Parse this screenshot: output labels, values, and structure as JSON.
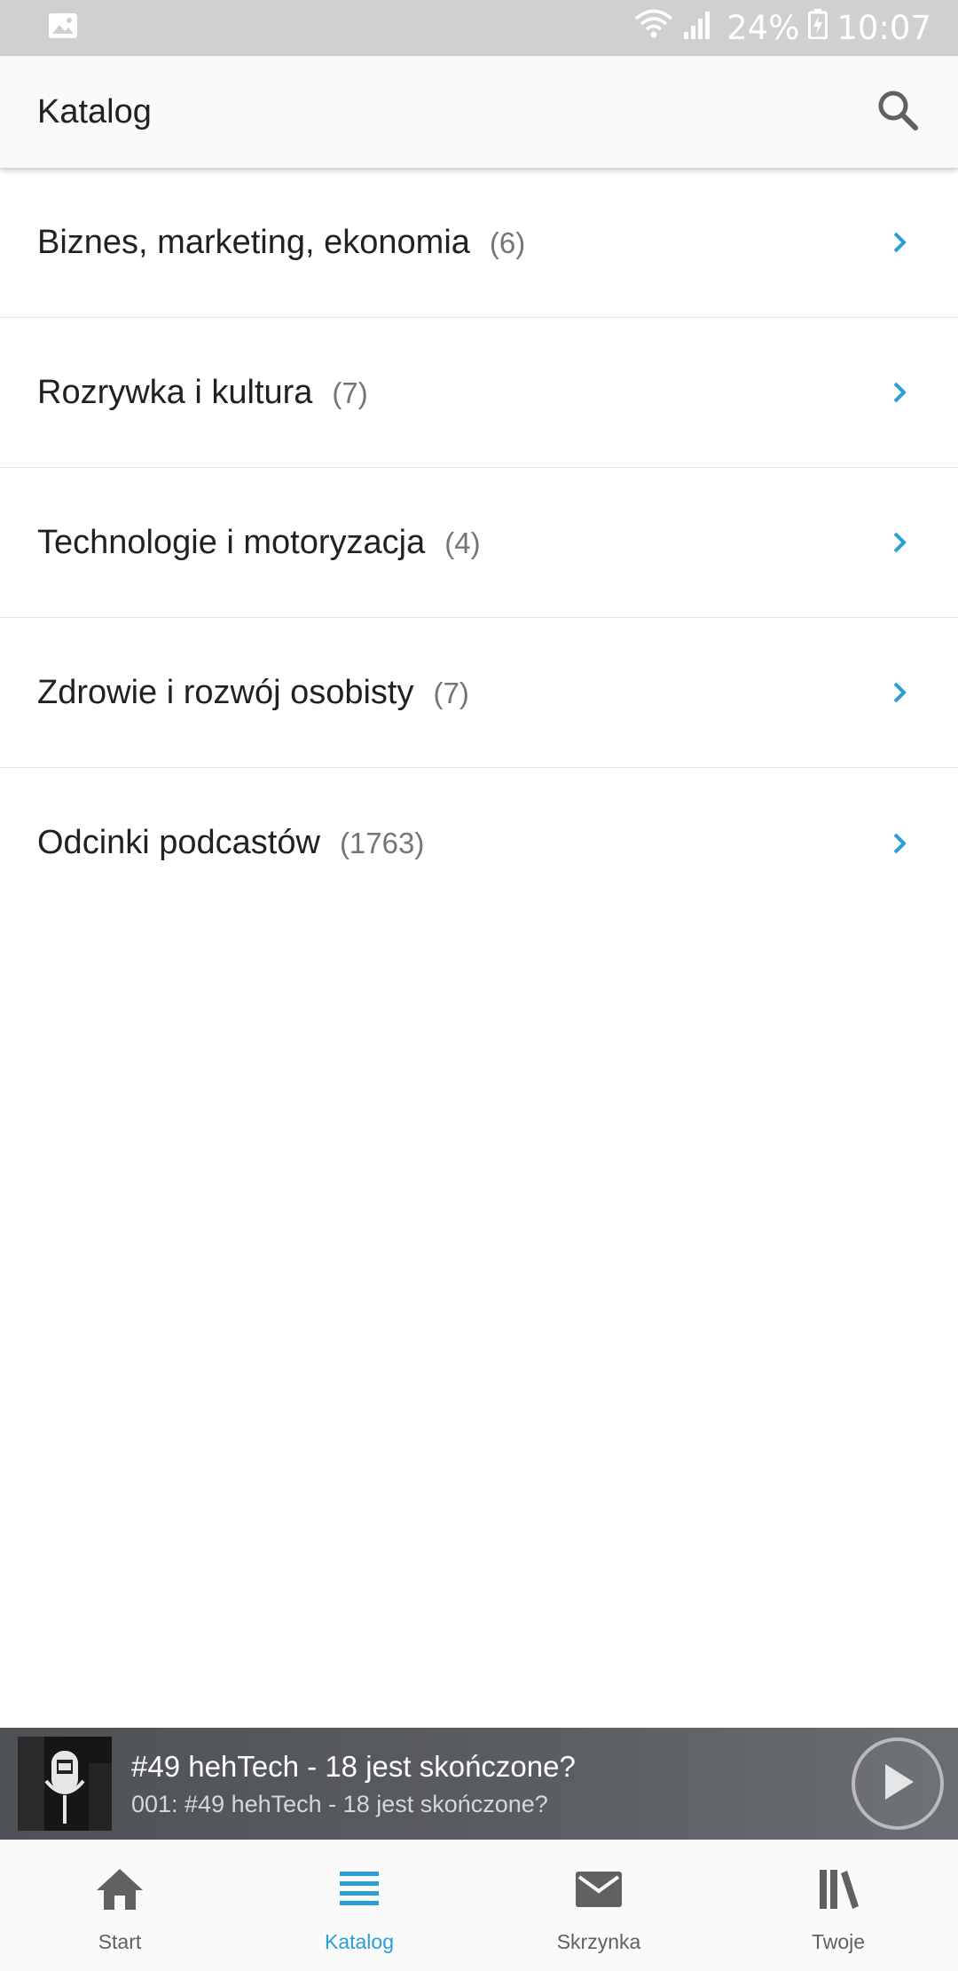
{
  "status_bar": {
    "battery": "24%",
    "time": "10:07",
    "icons": [
      "gallery-notification-icon",
      "wifi-icon",
      "signal-icon",
      "battery-charging-icon"
    ]
  },
  "app_bar": {
    "title": "Katalog",
    "search_icon": "search-icon"
  },
  "categories": [
    {
      "label": "Biznes, marketing, ekonomia",
      "count": "(6)"
    },
    {
      "label": "Rozrywka i kultura",
      "count": "(7)"
    },
    {
      "label": "Technologie i motoryzacja",
      "count": "(4)"
    },
    {
      "label": "Zdrowie i rozwój osobisty",
      "count": "(7)"
    },
    {
      "label": "Odcinki podcastów",
      "count": "(1763)"
    }
  ],
  "mini_player": {
    "title": "#49 hehTech - 18 jest skończone?",
    "subtitle": "001: #49 hehTech - 18 jest skończone?",
    "play_icon": "play-icon"
  },
  "bottom_nav": {
    "items": [
      {
        "label": "Start",
        "icon": "home-icon",
        "active": false
      },
      {
        "label": "Katalog",
        "icon": "list-icon",
        "active": true
      },
      {
        "label": "Skrzynka",
        "icon": "mail-icon",
        "active": false
      },
      {
        "label": "Twoje",
        "icon": "library-icon",
        "active": false
      }
    ]
  },
  "colors": {
    "accent": "#2a9fd6",
    "status_bar": "#cfd0d2",
    "player_bg": "#55585d",
    "text_primary": "#212121",
    "text_secondary": "#757575"
  }
}
